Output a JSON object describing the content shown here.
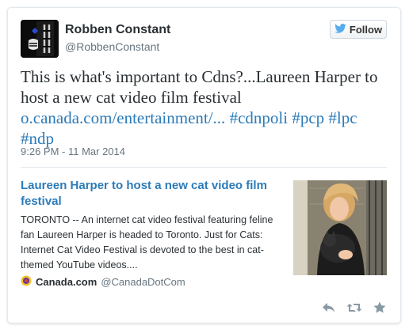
{
  "author": {
    "display_name": "Robben Constant",
    "handle": "@RobbenConstant"
  },
  "follow_button": {
    "label": "Follow"
  },
  "tweet": {
    "text": "This is what's important to Cdns?...Laureen Harper to host a new cat video film festival",
    "link": "o.canada.com/entertainment/...",
    "hashtags": [
      "#cdnpoli",
      "#pcp",
      "#lpc",
      "#ndp"
    ],
    "timestamp": "9:26 PM - 11 Mar 2014"
  },
  "card": {
    "title": "Laureen Harper to host a new cat video film festival",
    "description": "TORONTO -- An internet cat video festival featuring feline fan Laureen Harper is headed to Toronto. Just for Cats: Internet Cat Video Festival is devoted to the best in cat-themed YouTube videos....",
    "source_name": "Canada.com",
    "source_handle": "@CanadaDotCom"
  },
  "actions": [
    "reply-icon",
    "retweet-icon",
    "favorite-icon"
  ],
  "colors": {
    "link": "#2b7bb9",
    "text": "#292f33",
    "muted": "#66757f",
    "twitter_blue": "#55acee"
  }
}
